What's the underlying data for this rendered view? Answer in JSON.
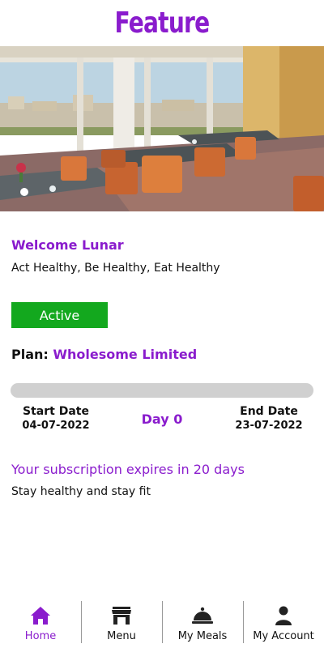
{
  "header": {
    "title": "Feature"
  },
  "hero": {
    "image": "restaurant-dining-room-photo"
  },
  "welcome": {
    "text": "Welcome Lunar",
    "tagline": "Act Healthy, Be Healthy, Eat Healthy"
  },
  "status": {
    "label": "Active",
    "color": "#13a81e"
  },
  "plan": {
    "label": "Plan:",
    "name": "Wholesome Limited"
  },
  "subscription": {
    "progress": 0,
    "start_label": "Start Date",
    "start_date": "04-07-2022",
    "day_label": "Day 0",
    "end_label": "End Date",
    "end_date": "23-07-2022",
    "expiry_text": "Your subscription expires in 20 days",
    "motto": "Stay healthy and stay fit"
  },
  "nav": {
    "items": [
      {
        "label": "Home",
        "icon": "home-icon",
        "active": true
      },
      {
        "label": "Menu",
        "icon": "store-icon",
        "active": false
      },
      {
        "label": "My Meals",
        "icon": "cloche-icon",
        "active": false
      },
      {
        "label": "My Account",
        "icon": "user-icon",
        "active": false
      }
    ]
  },
  "colors": {
    "accent": "#8a1ccd",
    "active_green": "#13a81e",
    "track": "#d0d0d0"
  }
}
